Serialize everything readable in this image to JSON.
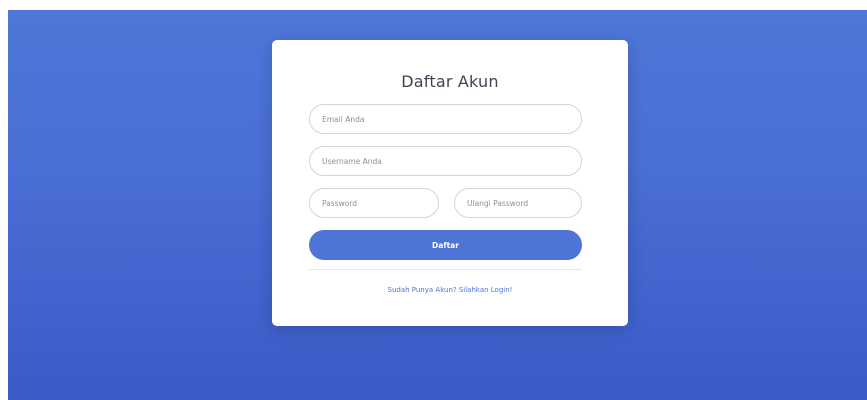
{
  "register_form": {
    "title": "Daftar Akun",
    "email_placeholder": "Email Anda",
    "username_placeholder": "Username Anda",
    "password_placeholder": "Password",
    "repeat_password_placeholder": "Ulangi Password",
    "submit_label": "Daftar",
    "login_link": "Sudah Punya Akun? Silahkan Login!"
  },
  "colors": {
    "background_gradient": [
      "#4e77d9",
      "#3a5bc7"
    ],
    "accent": "#4e74d8",
    "card": "#ffffff"
  }
}
